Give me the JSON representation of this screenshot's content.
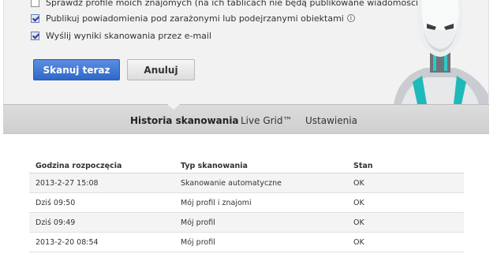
{
  "options": [
    {
      "label": "Sprawdź profile moich znajomych (na ich tablicach nie będą publikowane wiadomości)",
      "checked": false
    },
    {
      "label": "Publikuj powiadomienia pod zarażonymi lub podejrzanymi obiektami",
      "checked": true,
      "info_icon": "ⓘ"
    },
    {
      "label": "Wyślij wyniki skanowania przez e-mail",
      "checked": true
    }
  ],
  "buttons": {
    "scan_now": "Skanuj teraz",
    "cancel": "Anuluj"
  },
  "tabs": [
    {
      "label": "Historia skanowania",
      "active": true
    },
    {
      "label": "Live Grid™",
      "active": false
    },
    {
      "label": "Ustawienia",
      "active": false
    }
  ],
  "history": {
    "headers": [
      "Godzina rozpoczęcia",
      "Typ skanowania",
      "Stan"
    ],
    "rows": [
      [
        "2013-2-27 15:08",
        "Skanowanie automatyczne",
        "OK"
      ],
      [
        "Dziś 09:50",
        "Mój profil i znajomi",
        "OK"
      ],
      [
        "Dziś 09:49",
        "Mój profil",
        "OK"
      ],
      [
        "2013-2-20 08:54",
        "Mój profil",
        "OK"
      ]
    ]
  },
  "colors": {
    "primary_button": "#3a74d4",
    "panel_bg": "#f2f2f2",
    "tabbar_bg": "#d6d6d6",
    "robot_accent": "#21c6c6"
  }
}
